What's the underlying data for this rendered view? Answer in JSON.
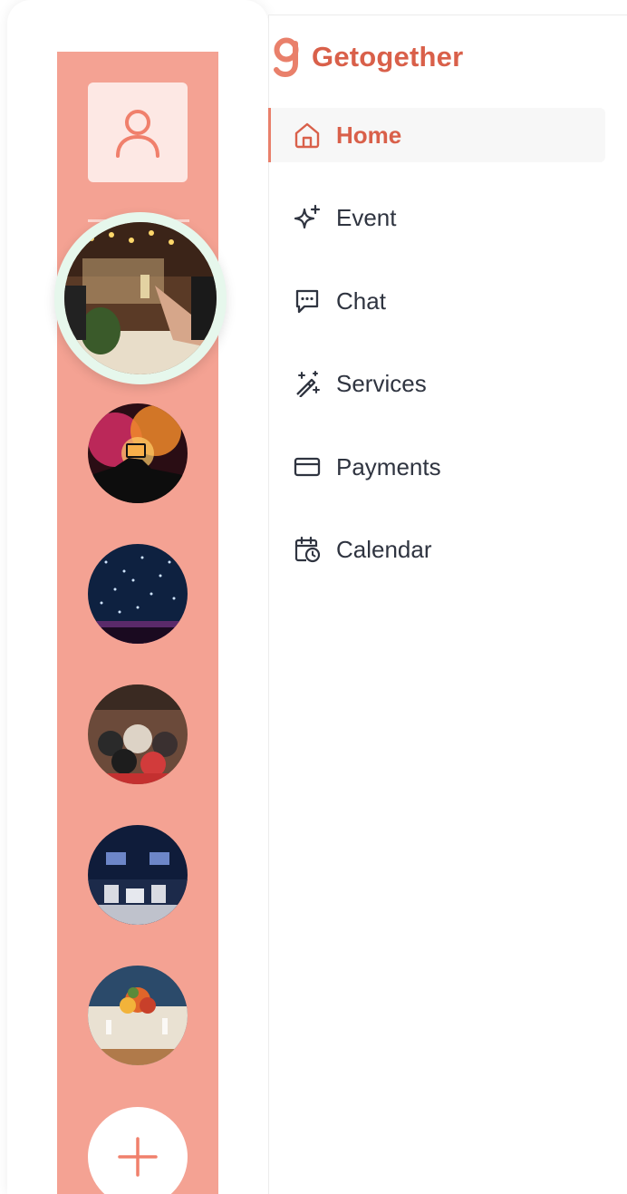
{
  "app": {
    "brand_name": "Getogether",
    "brand_color": "#d9604a",
    "rail_color": "#f4a293"
  },
  "rail": {
    "profile_icon": "user-icon",
    "add_icon": "plus-icon",
    "events": [
      {
        "name": "event-thumbnail-dinner-toast",
        "active": true
      },
      {
        "name": "event-thumbnail-concert-phone"
      },
      {
        "name": "event-thumbnail-confetti-crowd"
      },
      {
        "name": "event-thumbnail-banquet-hall"
      },
      {
        "name": "event-thumbnail-panel-stage"
      },
      {
        "name": "event-thumbnail-table-flowers"
      }
    ]
  },
  "nav": {
    "items": [
      {
        "label": "Home",
        "icon": "home-icon",
        "active": true
      },
      {
        "label": "Event",
        "icon": "sparkle-icon"
      },
      {
        "label": "Chat",
        "icon": "chat-icon"
      },
      {
        "label": "Services",
        "icon": "magic-wand-icon"
      },
      {
        "label": "Payments",
        "icon": "credit-card-icon"
      },
      {
        "label": "Calendar",
        "icon": "calendar-clock-icon"
      }
    ]
  }
}
